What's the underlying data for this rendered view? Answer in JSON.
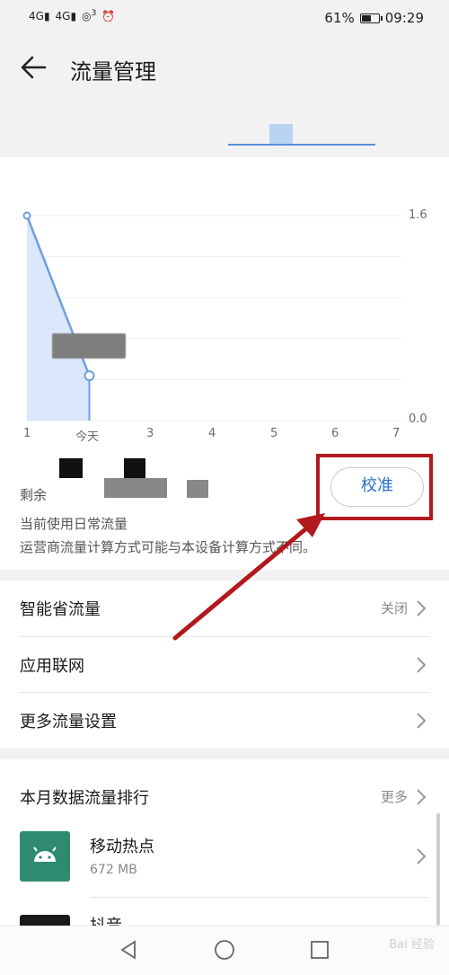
{
  "status_bar": {
    "signal1": "4G",
    "signal2": "4G",
    "hotspot_count": "3",
    "battery_percent": "61%",
    "battery_level": 0.61,
    "time": "09:29"
  },
  "header": {
    "title": "流量管理",
    "back_icon": "back-arrow-icon"
  },
  "chart_data": {
    "type": "line",
    "x": [
      "1",
      "今天",
      "3",
      "4",
      "5",
      "6",
      "7"
    ],
    "y_ticks": [
      "1.6",
      "0.0"
    ],
    "values": [
      1.6,
      0.35
    ],
    "ylim": [
      0,
      1.6
    ],
    "grid": true,
    "color": "#6f9ee0",
    "fill_color": "#dbe7fa"
  },
  "usage": {
    "remain_label": "剩余",
    "calibrate_button": "校准",
    "note1": "当前使用日常流量",
    "note2": "运营商流量计算方式可能与本设备计算方式不同。"
  },
  "settings": [
    {
      "label": "智能省流量",
      "value": "关闭"
    },
    {
      "label": "应用联网",
      "value": ""
    },
    {
      "label": "更多流量设置",
      "value": ""
    }
  ],
  "ranking": {
    "title": "本月数据流量排行",
    "more": "更多",
    "apps": [
      {
        "name": "移动热点",
        "size": "672 MB",
        "icon": "android-icon"
      },
      {
        "name": "抖音",
        "size": "",
        "icon": "douyin-icon"
      }
    ]
  },
  "colors": {
    "accent": "#2b6ec6",
    "highlight": "#b3191c"
  },
  "watermark": "Bai 经验"
}
